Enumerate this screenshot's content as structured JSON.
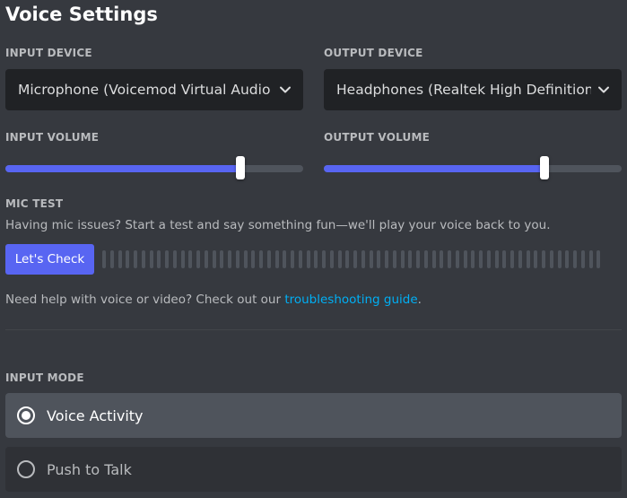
{
  "title": "Voice Settings",
  "input_device": {
    "label": "INPUT DEVICE",
    "value": "Microphone (Voicemod Virtual Audio Device (WDM))",
    "icon": "chevron-down-icon"
  },
  "output_device": {
    "label": "OUTPUT DEVICE",
    "value": "Headphones (Realtek High Definition Audio)",
    "icon": "chevron-down-icon"
  },
  "input_volume": {
    "label": "INPUT VOLUME",
    "level": 0.79
  },
  "output_volume": {
    "label": "OUTPUT VOLUME",
    "level": 0.74
  },
  "mic_test": {
    "label": "MIC TEST",
    "description": "Having mic issues? Start a test and say something fun—we'll play your voice back to you.",
    "button_label": "Let's Check",
    "meter_segments": 64
  },
  "help": {
    "prefix": "Need help with voice or video? Check out our ",
    "link_text": "troubleshooting guide",
    "suffix": "."
  },
  "input_mode": {
    "label": "INPUT MODE",
    "options": [
      {
        "label": "Voice Activity",
        "selected": true
      },
      {
        "label": "Push to Talk",
        "selected": false
      }
    ]
  },
  "colors": {
    "background": "#36393f",
    "accent": "#5865f2",
    "link": "#00aff4",
    "select_bg": "#202225"
  }
}
